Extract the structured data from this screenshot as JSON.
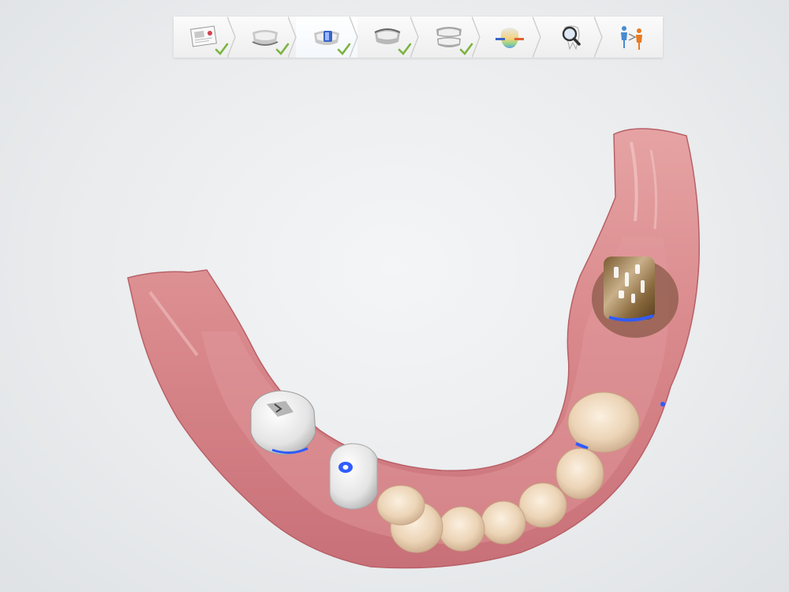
{
  "app": {
    "accent_check": "#7cb342",
    "background": "#eceef0"
  },
  "workflow": {
    "steps": [
      {
        "icon": "order-form-icon",
        "completed": true,
        "active": false
      },
      {
        "icon": "lower-jaw-scan-icon",
        "completed": true,
        "active": false
      },
      {
        "icon": "scan-body-scan-icon",
        "completed": true,
        "active": true
      },
      {
        "icon": "upper-jaw-scan-icon",
        "completed": true,
        "active": false
      },
      {
        "icon": "bite-scan-icon",
        "completed": true,
        "active": false
      },
      {
        "icon": "occlusal-clearance-icon",
        "completed": false,
        "active": false
      },
      {
        "icon": "tooth-inspection-icon",
        "completed": false,
        "active": false
      },
      {
        "icon": "send-to-lab-icon",
        "completed": false,
        "active": false
      }
    ]
  },
  "viewport": {
    "model": "lower-jaw-3d-scan",
    "colors": {
      "gingiva": "#d9868a",
      "teeth": "#efd9bf",
      "scan_body": "#f2f2f2",
      "gold_crown": "#a8834a",
      "highlight": "#2f5cff"
    }
  }
}
